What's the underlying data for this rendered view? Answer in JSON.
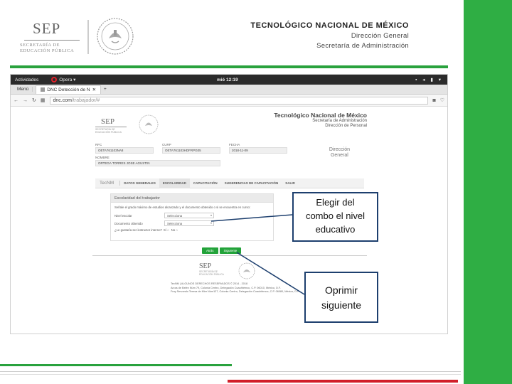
{
  "slide": {
    "logo": {
      "name": "SEP",
      "sub1": "SECRETARÍA DE",
      "sub2": "EDUCACIÓN PÚBLICA"
    },
    "header": {
      "title": "TECNOLÓGICO NACIONAL DE MÉXICO",
      "line1": "Dirección General",
      "line2": "Secretaría de Administración"
    },
    "colors": {
      "green": "#29a23d",
      "red": "#d11f2a",
      "callout_border": "#1d3f6e"
    }
  },
  "screenshot": {
    "topbar": {
      "activities": "Actividades",
      "app": "Opera",
      "clock": "mié 12:19"
    },
    "tabbar": {
      "menu": "Menú",
      "tab": "DNC Detección de N"
    },
    "addressbar": {
      "host": "dnc.com",
      "path": "/trabajador/#"
    },
    "page": {
      "header": {
        "title": "Tecnológico Nacional de México",
        "line1": "Secretaría de Administración",
        "line2": "Dirección de Personal"
      },
      "logo": {
        "name": "SEP",
        "sub1": "SECRETARÍA DE",
        "sub2": "EDUCACIÓN PÚBLICA"
      },
      "fields": {
        "rfc_label": "RFC",
        "rfc_value": "OETA761103NA8",
        "curp_label": "CURP",
        "curp_value": "OETA761103HDFRPG05",
        "fecha_label": "FECHA",
        "fecha_value": "2018-11-09",
        "nombre_label": "NOMBRE",
        "nombre_value": "ORTEGA TORRES JOSE AGUSTIN"
      },
      "side_label": {
        "line1": "Dirección",
        "line2": "General"
      },
      "tabs": {
        "brand": "TecNM",
        "items": [
          "DATOS GENERALES",
          "ESCOLARIDAD",
          "CAPACITACIÓN",
          "SUGERENCIAS DE CAPACITACIÓN",
          "SALIR"
        ]
      },
      "panel": {
        "title": "Escolaridad del trabajador",
        "instruction": "Señale el grado máximo de estudios alcanzado y el documento obtenido o si se encuentra en curso:",
        "nivel_label": "Nivel escolar",
        "nivel_value": "Selecciona",
        "documento_label": "Documento obtenido",
        "documento_value": "Selecciona",
        "question": "¿Le gustaría ser instructor interno?",
        "yes": "Sí",
        "no": "No"
      },
      "buttons": {
        "back": "Atrás",
        "next": "Siguiente"
      },
      "footer": {
        "line1": "TecNM | ALGUNOS DERECHOS RESERVADOS © 2014 - 2018",
        "line2": "Arcos de Belén Núm 79, Colonia Centro, Delegación Cuauhtémoc, C.P. 06010, México, D.F.",
        "line3": "Fray Servando Teresa de Mier Núm127, Colonia Centro, Delegación Cuauhtémoc, C.P. 06080, México, D.F."
      }
    }
  },
  "callouts": {
    "first": {
      "line1": "Elegir del",
      "line2": "combo el nivel",
      "line3": "educativo"
    },
    "second": {
      "line1": "Oprimir",
      "line2": "siguiente"
    }
  }
}
